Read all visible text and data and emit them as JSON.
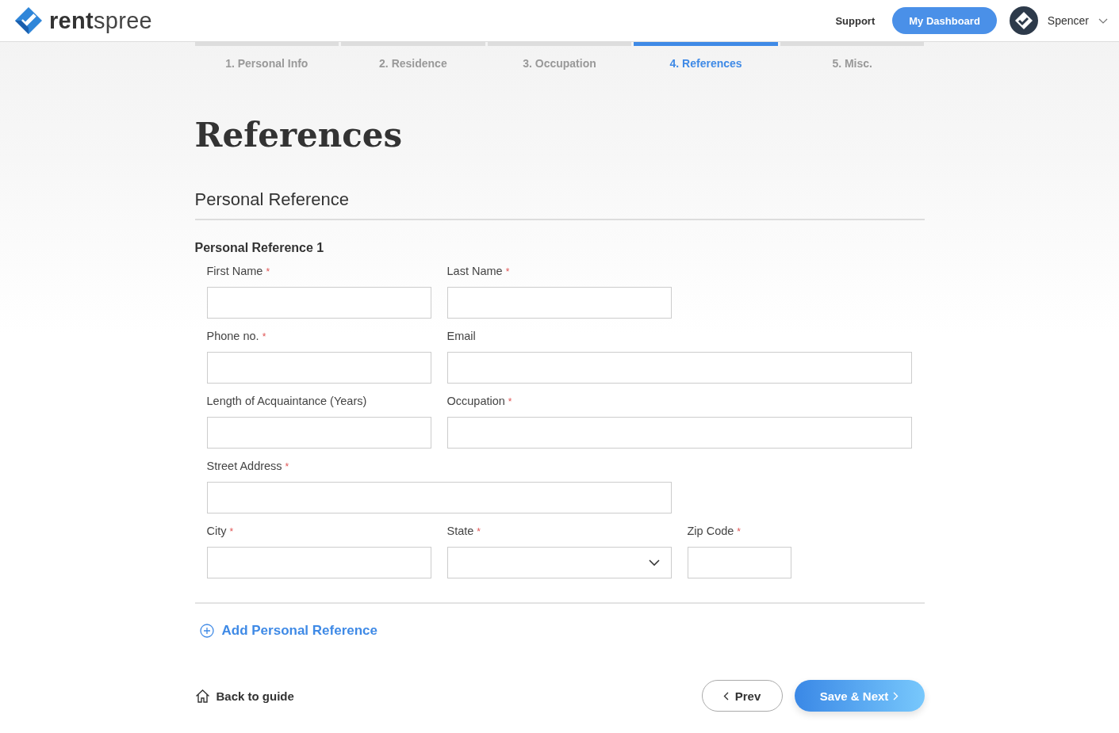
{
  "header": {
    "logo": "**rent**spree",
    "links": [
      {
        "label": "Support",
        "kind": "link"
      },
      {
        "label": "My Dashboard",
        "kind": "button"
      }
    ],
    "user": "Spencer"
  },
  "steps": [
    {
      "label": "1. Personal Info",
      "selected": false
    },
    {
      "label": "2. Residence",
      "selected": false
    },
    {
      "label": "3. Occupation",
      "selected": false
    },
    {
      "label": "4. References",
      "selected": true
    },
    {
      "label": "5. Misc.",
      "selected": false
    }
  ],
  "title": "References",
  "section": "Personal Reference",
  "subsection": "Personal Reference 1",
  "rows": [
    [
      {
        "label": "First Name",
        "required": true,
        "kind": "text"
      },
      {
        "label": "Last Name",
        "required": true,
        "kind": "text"
      }
    ],
    [
      {
        "label": "Phone no.",
        "required": true,
        "kind": "text"
      },
      {
        "label": "Email",
        "required": false,
        "kind": "wide"
      }
    ],
    [
      {
        "label": "Length of Acquaintance (Years)",
        "required": false,
        "kind": "text"
      },
      {
        "label": "Occupation",
        "required": true,
        "kind": "wide"
      }
    ],
    [
      {
        "label": "Street Address",
        "required": true,
        "kind": "wide"
      }
    ],
    [
      {
        "label": "City",
        "required": true,
        "kind": "text"
      },
      {
        "label": "State",
        "required": true,
        "kind": "select"
      },
      {
        "label": "Zip Code",
        "required": true,
        "kind": "short"
      }
    ]
  ],
  "required_mark": "*",
  "add_link": "Add Personal Reference",
  "footer": {
    "back": "Back to guide",
    "prev": "Prev",
    "next": "Save & Next"
  }
}
